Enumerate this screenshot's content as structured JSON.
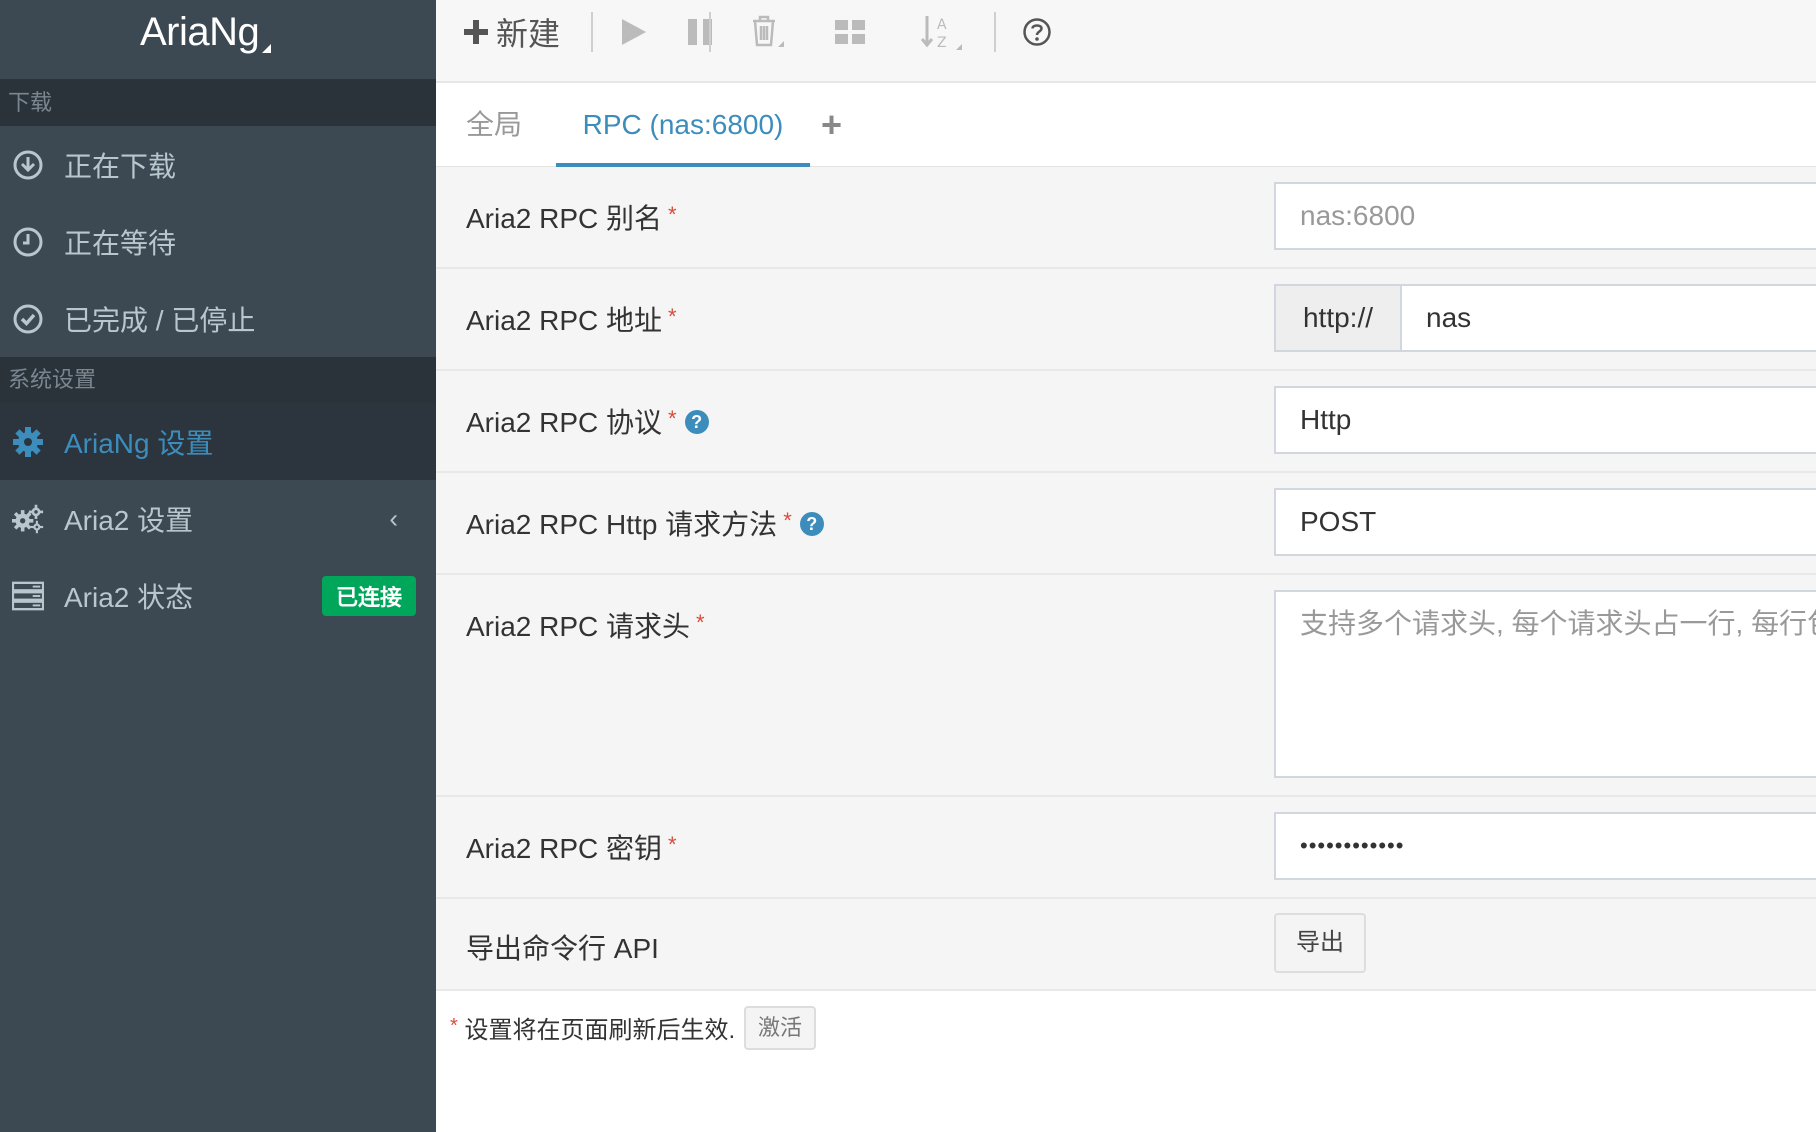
{
  "app": {
    "title": "AriaNg"
  },
  "sidebar": {
    "section_downloads": "下载",
    "downloading": "正在下载",
    "waiting": "正在等待",
    "stopped": "已完成 / 已停止",
    "section_settings": "系统设置",
    "ariang_settings": "AriaNg 设置",
    "aria2_settings": "Aria2 设置",
    "aria2_status": "Aria2 状态",
    "status_badge": "已连接"
  },
  "toolbar": {
    "new_label": "新建",
    "icons": [
      "plus-icon",
      "play-icon",
      "pause-icon",
      "trash-icon",
      "grid-icon",
      "sort-az-icon",
      "help-circle-icon"
    ]
  },
  "tabs": {
    "global": "全局",
    "rpc": "RPC (nas:6800)",
    "add": "+"
  },
  "form": {
    "alias": {
      "label": "Aria2 RPC 别名",
      "placeholder": "nas:6800"
    },
    "address": {
      "label": "Aria2 RPC 地址",
      "protocol_prefix": "http://",
      "value": "nas"
    },
    "protocol": {
      "label": "Aria2 RPC 协议",
      "value": "Http"
    },
    "method": {
      "label": "Aria2 RPC Http 请求方法",
      "value": "POST"
    },
    "headers": {
      "label": "Aria2 RPC 请求头",
      "placeholder": "支持多个请求头, 每个请求头占一行, 每行包"
    },
    "secret": {
      "label": "Aria2 RPC 密钥",
      "value": "••••••••••••"
    },
    "export": {
      "label": "导出命令行 API",
      "button": "导出"
    },
    "required_mark": "*",
    "help_mark": "?"
  },
  "footer": {
    "note": "设置将在页面刷新后生效.",
    "activate_button": "激活"
  },
  "colors": {
    "sidebar_bg": "#3c4852",
    "accent": "#3c8dbc",
    "success": "#00a65a",
    "required": "#dd4b39"
  }
}
